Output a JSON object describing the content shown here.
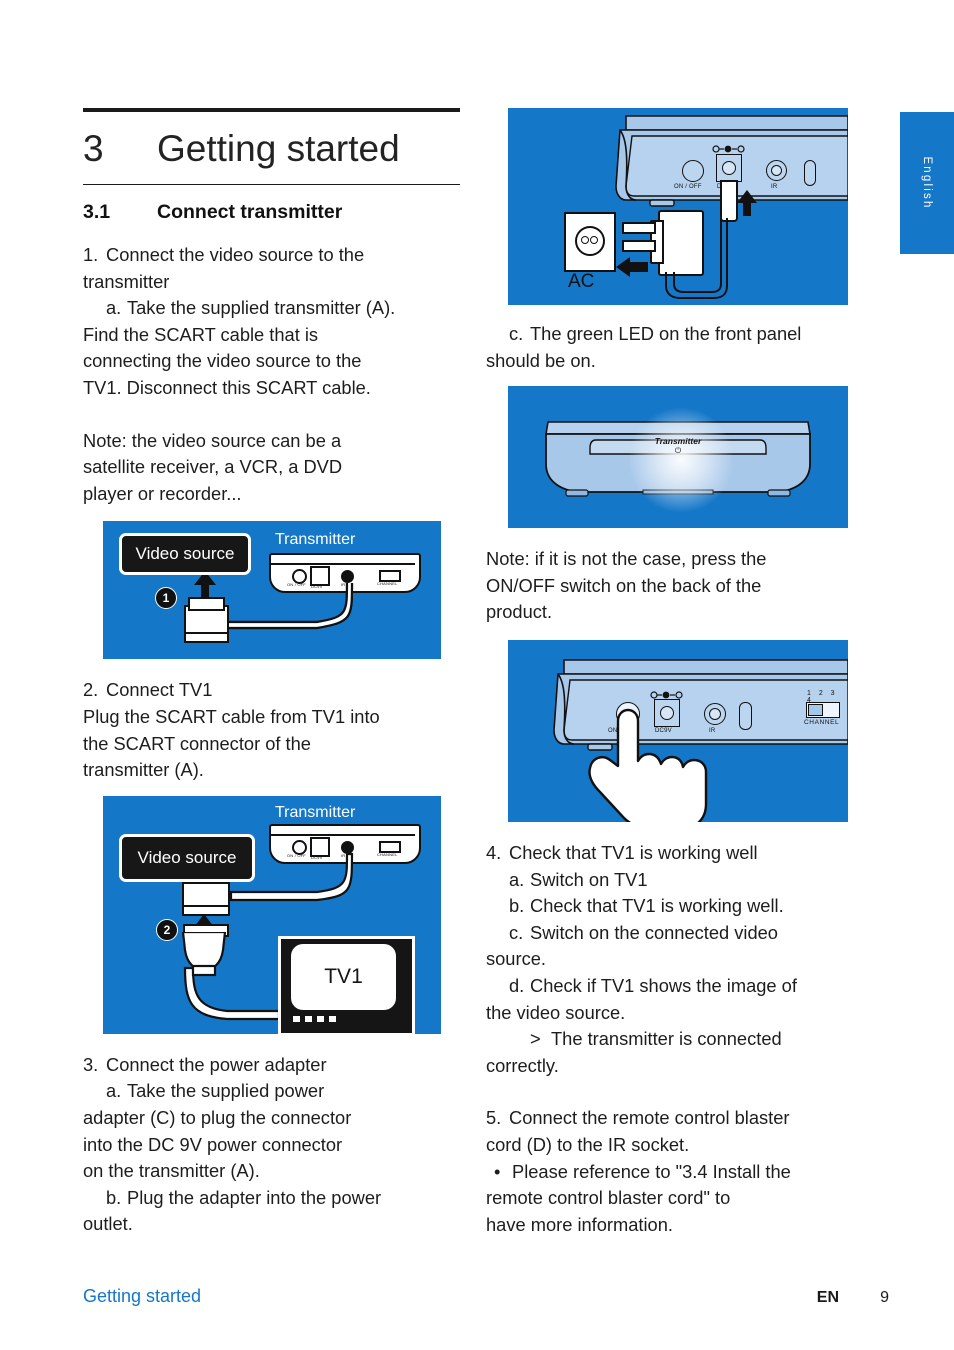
{
  "document": {
    "chapter_number": "3",
    "chapter_title": "Getting started",
    "section_number": "3.1",
    "section_title": "Connect transmitter"
  },
  "language_tab": "English",
  "left_column": {
    "step1": {
      "marker": "1.",
      "title": "Connect the video source to the",
      "title_cont": "transmitter",
      "sub_a_marker": "a.",
      "sub_a_line1": "Take the supplied transmitter (A).",
      "sub_a_line2": "Find the SCART cable that is",
      "sub_a_line3": "connecting the video source to the",
      "sub_a_line4": "TV1. Disconnect this SCART cable.",
      "note_line1": "Note: the video source can be a",
      "note_line2": "satellite receiver, a VCR, a DVD",
      "note_line3": "player or recorder..."
    },
    "figure1": {
      "video_source_label": "Video source",
      "transmitter_label": "Transmitter",
      "step_badge": "1",
      "port_labels": [
        "ON / OFF",
        "DC9V",
        "IR",
        "CHANNEL"
      ]
    },
    "step2": {
      "marker": "2.",
      "title": "Connect TV1",
      "line1": "Plug the SCART cable from TV1 into",
      "line2": "the SCART connector of the",
      "line3": "transmitter (A)."
    },
    "figure2": {
      "video_source_label": "Video source",
      "transmitter_label": "Transmitter",
      "step_badge": "2",
      "tv_label": "TV1",
      "port_labels": [
        "ON / OFF",
        "DC9V",
        "IR",
        "CHANNEL"
      ]
    },
    "step3": {
      "marker": "3.",
      "title": "Connect the power adapter",
      "sub_a_marker": "a.",
      "sub_a_line1": "Take the supplied power",
      "sub_a_line2": "adapter (C) to plug the connector",
      "sub_a_line3": "into the DC 9V power connector",
      "sub_a_line4": "on the transmitter (A).",
      "sub_b_marker": "b.",
      "sub_b_line1": "Plug the adapter into the power",
      "sub_b_line2": "outlet."
    }
  },
  "right_column": {
    "figure3": {
      "ac_label": "AC",
      "port_onoff": "ON / OFF",
      "port_dc": "DC9V",
      "port_ir": "IR"
    },
    "step3c": {
      "marker": "c.",
      "line1": "The green LED on the front panel",
      "line2": "should be on."
    },
    "figure4": {
      "front_label": "Transmitter",
      "power_glyph": "⏻"
    },
    "note": {
      "line1": "Note: if it is not the case, press the",
      "line2": "ON/OFF switch on the back of the",
      "line3": "product."
    },
    "figure5": {
      "port_onoff": "ON / OFF",
      "port_dc": "DC9V",
      "port_ir": "IR",
      "channel_numbers": "1 2 3 4",
      "channel_label": "CHANNEL"
    },
    "step4": {
      "marker": "4.",
      "title": "Check that TV1 is working well",
      "a_marker": "a.",
      "a_text": "Switch on TV1",
      "b_marker": "b.",
      "b_text": "Check that TV1 is working well.",
      "c_marker": "c.",
      "c_line1": "Switch on the connected video",
      "c_line2": "source.",
      "d_marker": "d.",
      "d_line1": "Check if TV1 shows the image of",
      "d_line2": "the video source.",
      "result_marker": ">",
      "result_line1": "The transmitter is connected",
      "result_line2": "correctly."
    },
    "step5": {
      "marker": "5.",
      "line1": "Connect the remote control blaster",
      "line2": "cord (D) to the IR socket.",
      "bullet_marker": "•",
      "bullet_line1": "Please reference to \"3.4 Install the",
      "bullet_line2": "remote control blaster cord\" to",
      "bullet_line3": "have more information."
    }
  },
  "footer": {
    "left": "Getting started",
    "lang_code": "EN",
    "page_number": "9"
  },
  "colors": {
    "brand_blue": "#1577c8",
    "text": "#1d1d1d",
    "figure_bg": "#1577c8",
    "panel_fill": "#9cc2e8"
  }
}
